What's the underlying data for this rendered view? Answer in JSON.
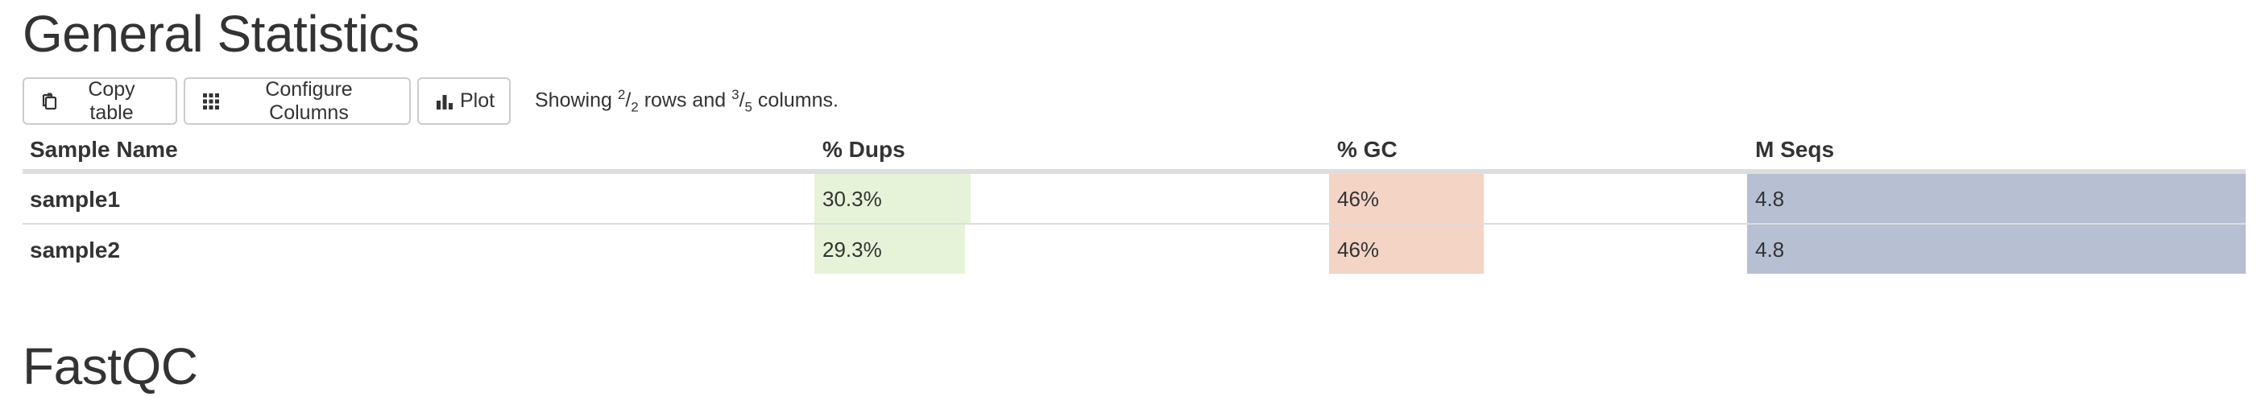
{
  "sections": {
    "general_title": "General Statistics",
    "fastqc_title": "FastQC"
  },
  "toolbar": {
    "copy_label": "Copy table",
    "configure_label": "Configure Columns",
    "plot_label": "Plot",
    "showing_prefix": "Showing ",
    "rows_shown": "2",
    "rows_total": "2",
    "rows_word": " rows and ",
    "cols_shown": "3",
    "cols_total": "5",
    "cols_word": " columns."
  },
  "table": {
    "headers": [
      "Sample Name",
      "% Dups",
      "% GC",
      "M Seqs"
    ],
    "rows": [
      {
        "name": "sample1",
        "dups": "30.3%",
        "dups_fraction": 0.303,
        "gc": "46%",
        "gc_fraction": 0.37,
        "mseqs": "4.8",
        "mseqs_fraction": 1.0
      },
      {
        "name": "sample2",
        "dups": "29.3%",
        "dups_fraction": 0.293,
        "gc": "46%",
        "gc_fraction": 0.37,
        "mseqs": "4.8",
        "mseqs_fraction": 1.0
      }
    ]
  },
  "colors": {
    "dups_bar": "#e6f3d8",
    "gc_bar": "#f3d4c5",
    "mseqs_bar": "#b7c0d3"
  }
}
